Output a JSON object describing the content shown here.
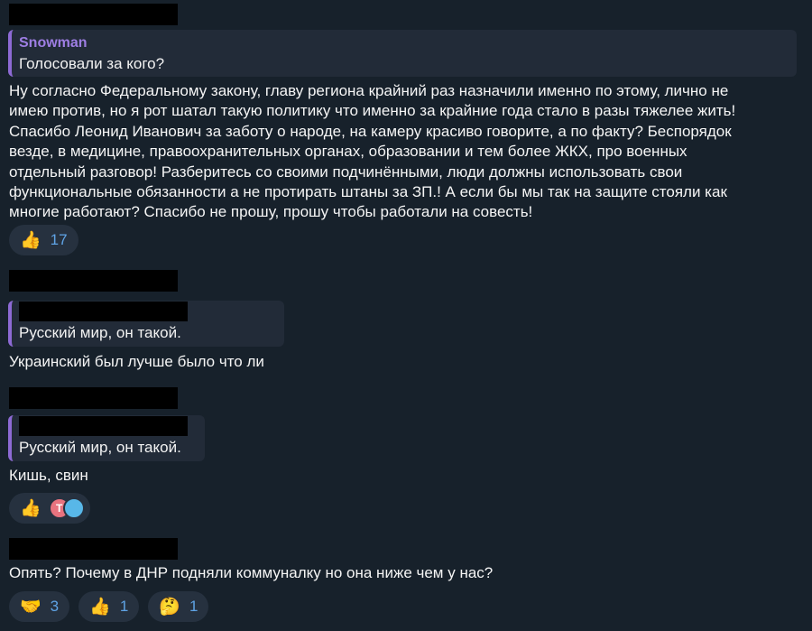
{
  "messages": [
    {
      "reply": {
        "author": "Snowman",
        "text": "Голосовали за кого?"
      },
      "text": "Ну согласно Федеральному закону, главу региона крайний раз назначили именно по этому, лично не\nимею против, но я рот шатал такую политику что именно за крайние года стало в разы тяжелее жить!\nСпасибо Леонид Иванович за заботу о народе, на камеру красиво говорите, а по факту? Беспорядок\nвезде, в медицине, правоохранительных органах, образовании и тем более ЖКХ, про военных\nотдельный разговор! Разберитесь со своими подчинёнными, люди должны использовать свои\nфункциональные обязанности а не протирать штаны за ЗП.! А если бы мы так на защите стояли как\nмногие работают? Спасибо не прошу, прошу чтобы работали на совесть!",
      "reactions": [
        {
          "emoji": "👍",
          "emoji_name": "thumbs-up-icon",
          "count": "17"
        }
      ]
    },
    {
      "reply": {
        "text": "Русский мир, он такой."
      },
      "text": "Украинский был лучше было что ли"
    },
    {
      "reply": {
        "text": "Русский мир, он такой."
      },
      "text": "Кишь, свин",
      "reactions": [
        {
          "emoji": "👍",
          "emoji_name": "thumbs-up-icon",
          "avatars": [
            {
              "letter": "T",
              "color": "#e8737f"
            },
            {
              "letter": "",
              "color": "#58b7e8"
            }
          ]
        }
      ]
    },
    {
      "text": "Опять? Почему в ДНР подняли коммуналку но она ниже чем у нас?",
      "reactions": [
        {
          "emoji": "🤝",
          "emoji_name": "handshake-icon",
          "count": "3"
        },
        {
          "emoji": "👍",
          "emoji_name": "thumbs-up-icon",
          "count": "1"
        },
        {
          "emoji": "🤔",
          "emoji_name": "thinking-face-icon",
          "count": "1"
        }
      ]
    }
  ]
}
